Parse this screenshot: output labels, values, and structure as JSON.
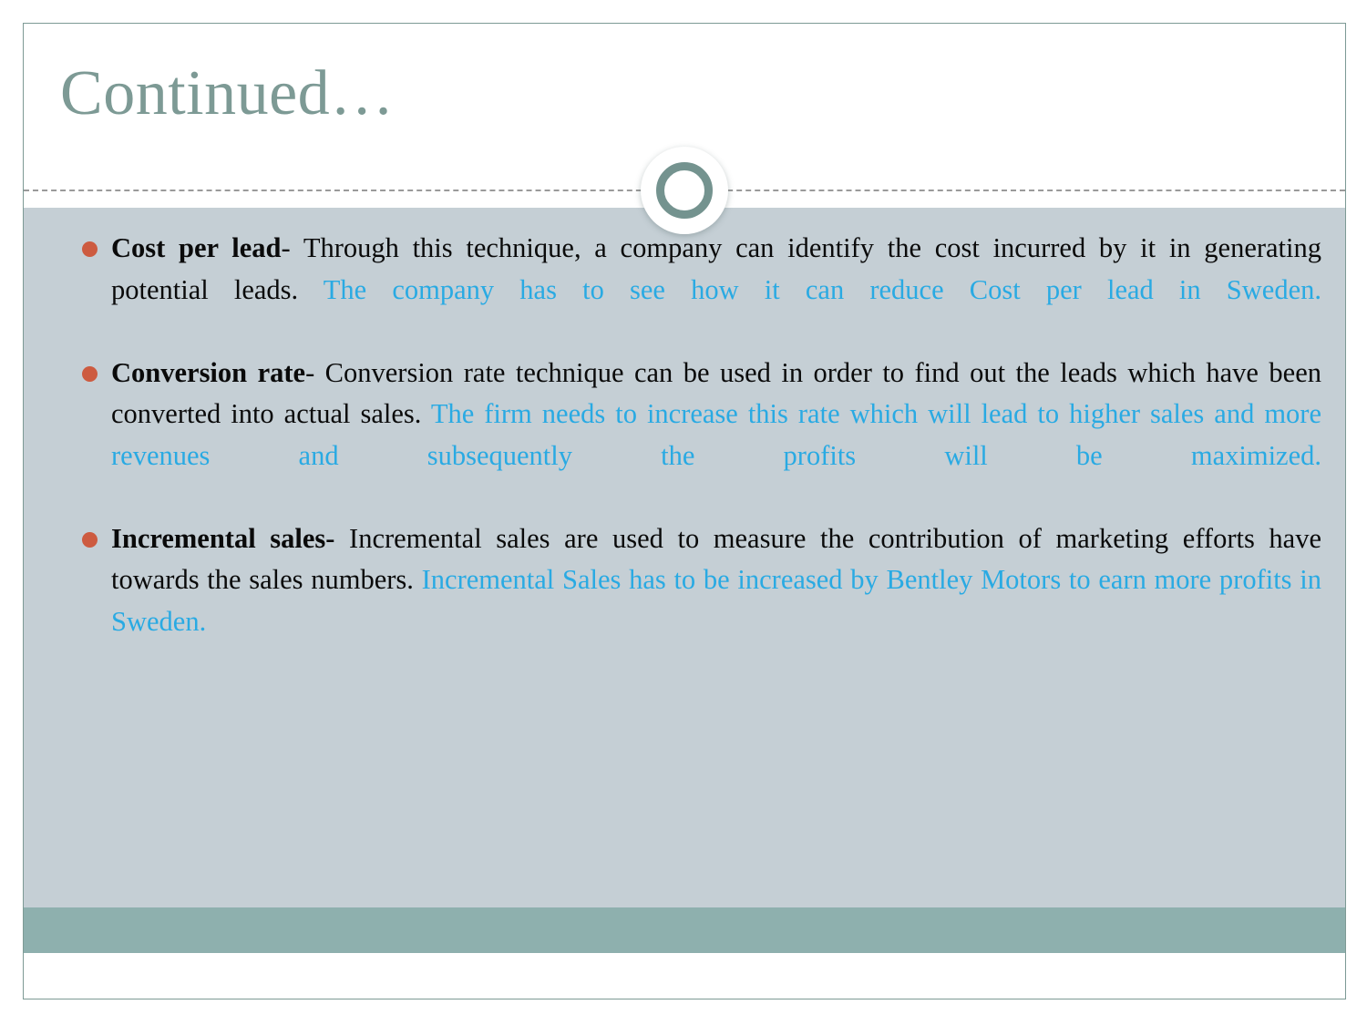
{
  "slide": {
    "title": "Continued…",
    "theme": {
      "title_color": "#7d9a95",
      "body_background": "#c5cfd5",
      "footer_color": "#8eb0ae",
      "bullet_color": "#cd5b40",
      "highlight_color": "#29aae3",
      "body_text_color": "#0a0a0a",
      "border_color": "#7d9a95"
    },
    "decoration": {
      "ring_icon": "circle-ring-icon"
    }
  },
  "bullets": [
    {
      "lead": "Cost per lead",
      "plain": "- Through this technique, a company can identify the cost incurred by it in generating potential leads. ",
      "highlight": "The company has to see how it can reduce Cost per lead in Sweden."
    },
    {
      "lead": "Conversion rate",
      "plain": "- Conversion rate technique can be used in order to find out the leads which have been converted into actual sales. ",
      "highlight": "The firm needs to increase this rate which will lead to higher sales and more revenues and subsequently the profits will be maximized."
    },
    {
      "lead": "Incremental sales-",
      "plain": " Incremental sales are used to measure the contribution of marketing efforts have towards the sales numbers. ",
      "highlight": "Incremental Sales has to be increased by Bentley Motors to earn more profits in Sweden."
    }
  ]
}
